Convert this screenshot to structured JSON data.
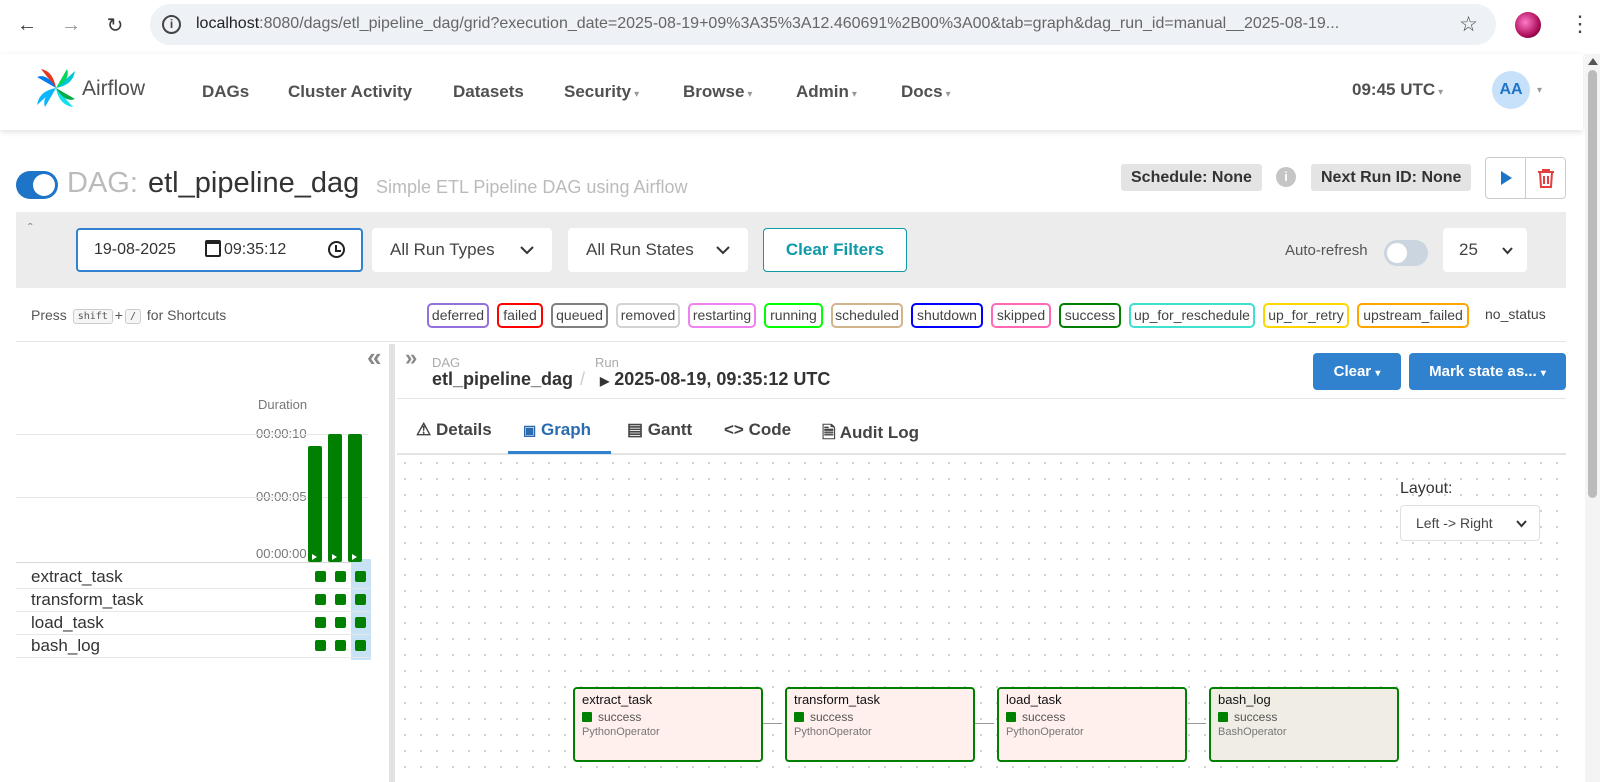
{
  "browser": {
    "url_host": "localhost",
    "url_rest": ":8080/dags/etl_pipeline_dag/grid?execution_date=2025-08-19+09%3A35%3A12.460691%2B00%3A00&tab=graph&dag_run_id=manual__2025-08-19..."
  },
  "nav": {
    "logo": "Airflow",
    "items": [
      "DAGs",
      "Cluster Activity",
      "Datasets",
      "Security",
      "Browse",
      "Admin",
      "Docs"
    ],
    "clock": "09:45 UTC",
    "user_initials": "AA"
  },
  "dag": {
    "label": "DAG:",
    "name": "etl_pipeline_dag",
    "description": "Simple ETL Pipeline DAG using Airflow",
    "schedule": "Schedule: None",
    "next_run": "Next Run ID: None"
  },
  "filters": {
    "date": "19-08-2025",
    "time": "09:35:12",
    "run_types": "All Run Types",
    "run_states": "All Run States",
    "clear_filters": "Clear Filters",
    "auto_refresh": "Auto-refresh",
    "num_runs": "25"
  },
  "shortcuts": {
    "press": "Press",
    "key1": "shift",
    "plus": "+",
    "key2": "/",
    "suffix": "for Shortcuts"
  },
  "states": [
    "deferred",
    "failed",
    "queued",
    "removed",
    "restarting",
    "running",
    "scheduled",
    "shutdown",
    "skipped",
    "success",
    "up_for_reschedule",
    "up_for_retry",
    "upstream_failed",
    "no_status"
  ],
  "state_colors": {
    "deferred": "#9370db",
    "failed": "#ff0000",
    "queued": "#808080",
    "removed": "#d3d3d3",
    "restarting": "#ee82ee",
    "running": "#00ff00",
    "scheduled": "#d2b48c",
    "shutdown": "#0000ff",
    "skipped": "#ff69b4",
    "success": "#008000",
    "up_for_reschedule": "#40e0d0",
    "up_for_retry": "#ffd700",
    "upstream_failed": "#ffa500"
  },
  "grid": {
    "duration_label": "Duration",
    "ticks": [
      "00:00:10",
      "00:00:05",
      "00:00:00"
    ],
    "run_durations_sec": [
      9.1,
      10,
      10
    ],
    "tasks": [
      "extract_task",
      "transform_task",
      "load_task",
      "bash_log"
    ]
  },
  "details": {
    "dag_label": "DAG",
    "dag_name": "etl_pipeline_dag",
    "run_label": "Run",
    "run_value": "2025-08-19, 09:35:12 UTC",
    "clear": "Clear",
    "mark_state": "Mark state as...",
    "tabs": [
      "Details",
      "Graph",
      "Gantt",
      "Code",
      "Audit Log"
    ],
    "active_tab": "Graph"
  },
  "graph": {
    "layout_label": "Layout:",
    "layout_value": "Left -> Right",
    "nodes": [
      {
        "name": "extract_task",
        "state": "success",
        "operator": "PythonOperator"
      },
      {
        "name": "transform_task",
        "state": "success",
        "operator": "PythonOperator"
      },
      {
        "name": "load_task",
        "state": "success",
        "operator": "PythonOperator"
      },
      {
        "name": "bash_log",
        "state": "success",
        "operator": "BashOperator"
      }
    ]
  }
}
